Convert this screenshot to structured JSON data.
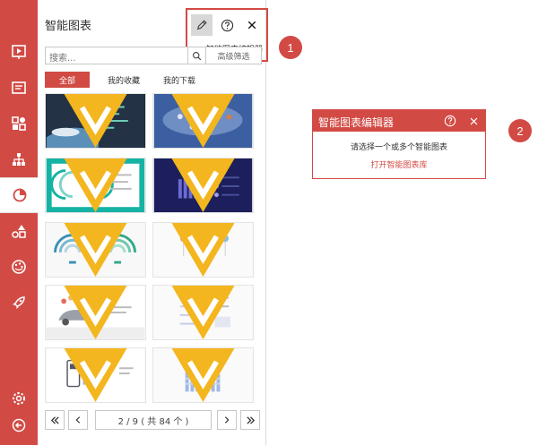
{
  "colors": {
    "accent": "#d24a44",
    "vip": "#f3b61f"
  },
  "rail": {
    "items": [
      {
        "icon": "slideshow-icon"
      },
      {
        "icon": "text-box-icon"
      },
      {
        "icon": "shapes-grid-icon"
      },
      {
        "icon": "org-chart-icon"
      },
      {
        "icon": "smart-chart-icon",
        "active": true
      },
      {
        "icon": "shapes-icon"
      },
      {
        "icon": "palette-icon"
      },
      {
        "icon": "rocket-icon"
      }
    ],
    "bottom": [
      {
        "icon": "settings-icon"
      },
      {
        "icon": "collapse-icon"
      }
    ]
  },
  "panel": {
    "title": "智能图表",
    "tooltip": "智能图表编辑器",
    "search_placeholder": "搜索...",
    "advanced_label": "高级筛选",
    "tabs": [
      "全部",
      "我的收藏",
      "我的下载"
    ],
    "pager_text": "2 / 9 ( 共 84 个 )"
  },
  "badges": [
    "1",
    "2"
  ],
  "editor": {
    "title": "智能图表编辑器",
    "message": "请选择一个或多个智能图表",
    "link": "打开智能图表库"
  }
}
